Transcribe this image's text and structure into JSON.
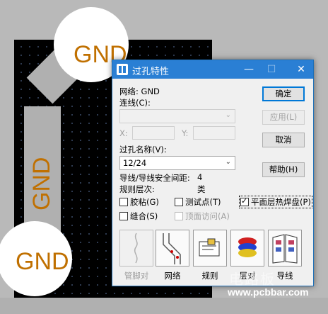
{
  "board": {
    "pad_top_label": "GND",
    "pad_bottom_label": "GND",
    "trace_label": "GND"
  },
  "dialog": {
    "title": "过孔特性",
    "net_label": "网络: GND",
    "route_label": "连线(C):",
    "route_value": "",
    "x_label": "X:",
    "y_label": "Y:",
    "via_name_label": "过孔名称(V):",
    "via_name_value": "12/24",
    "clearance_label": "导线/导线安全间距:",
    "clearance_value": "4",
    "rule_level_label": "规则层次:",
    "rule_level_value": "类",
    "buttons": {
      "ok": "确定",
      "apply": "应用(L)",
      "cancel": "取消",
      "help": "帮助(H)"
    },
    "checkboxes": {
      "glue": "胶粘(G)",
      "testpoint": "测试点(T)",
      "thermal": "平面层热焊盘(P)",
      "stitch": "缝合(S)",
      "page_access": "顶面访问(A)"
    },
    "tiles": [
      {
        "label": "管脚对"
      },
      {
        "label": "网络"
      },
      {
        "label": "规则"
      },
      {
        "label": "层对"
      },
      {
        "label": "导线"
      }
    ]
  },
  "watermark": {
    "top": "电路板",
    "url": "www.pcbbar.com"
  },
  "colors": {
    "title_bar": "#2a7fd4",
    "pad_label": "#c07000"
  }
}
